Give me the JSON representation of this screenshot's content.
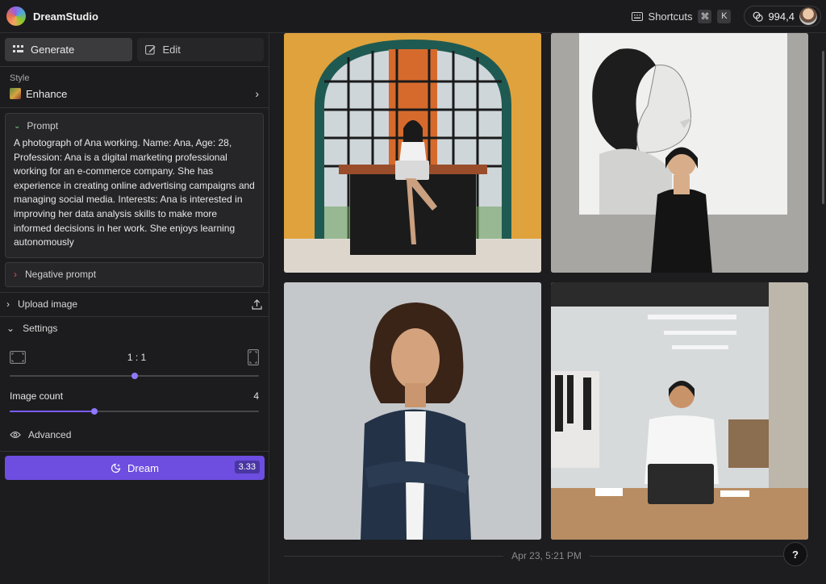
{
  "app": {
    "title": "DreamStudio"
  },
  "header": {
    "shortcuts_label": "Shortcuts",
    "shortcut_keys": [
      "⌘",
      "K"
    ],
    "credits": "994,4"
  },
  "sidebar": {
    "tabs": [
      {
        "label": "Generate",
        "active": true
      },
      {
        "label": "Edit",
        "active": false
      }
    ],
    "style": {
      "label": "Style",
      "value": "Enhance"
    },
    "prompt": {
      "label": "Prompt",
      "text": "A photograph of Ana working. Name: Ana,  Age: 28, Profession: Ana is a digital marketing professional working for an e-commerce company. She has experience in creating online advertising campaigns and managing social media.  Interests: Ana is interested in improving her data analysis skills to make more informed decisions in her work. She enjoys learning autonomously"
    },
    "negative_prompt_label": "Negative prompt",
    "upload_label": "Upload image",
    "settings": {
      "label": "Settings",
      "aspect_ratio": "1 : 1",
      "aspect_slider_fraction": 0.5,
      "image_count_label": "Image count",
      "image_count": "4",
      "image_count_fraction": 0.34,
      "advanced_label": "Advanced"
    },
    "dream_button": {
      "label": "Dream",
      "cost": "3.33"
    }
  },
  "main": {
    "timestamp": "Apr 23, 5:21 PM",
    "help_label": "?"
  },
  "colors": {
    "accent": "#6d4ee0",
    "prompt_chevron": "#6fd18f",
    "negative_chevron": "#e0555c"
  }
}
